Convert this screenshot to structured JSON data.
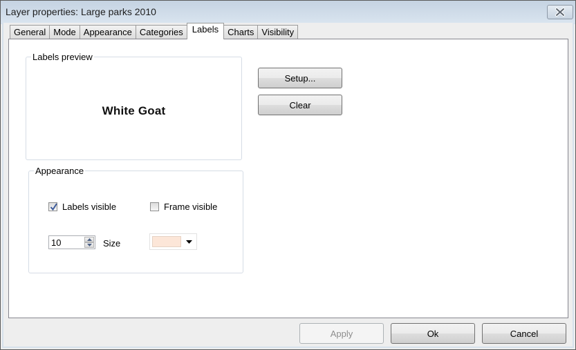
{
  "window": {
    "title": "Layer properties: Large parks 2010",
    "close_icon": "close-icon"
  },
  "tabs": [
    {
      "label": "General",
      "active": false
    },
    {
      "label": "Mode",
      "active": false
    },
    {
      "label": "Appearance",
      "active": false
    },
    {
      "label": "Categories",
      "active": false
    },
    {
      "label": "Labels",
      "active": true
    },
    {
      "label": "Charts",
      "active": false
    },
    {
      "label": "Visibility",
      "active": false
    }
  ],
  "labels_tab": {
    "preview": {
      "group_label": "Labels preview",
      "sample_text": "White Goat"
    },
    "buttons": {
      "setup": "Setup...",
      "clear": "Clear"
    },
    "appearance": {
      "group_label": "Appearance",
      "labels_visible": {
        "label": "Labels visible",
        "checked": true
      },
      "frame_visible": {
        "label": "Frame visible",
        "checked": false
      },
      "size": {
        "value": "10",
        "label": "Size"
      },
      "color": {
        "value": "#fce6d8"
      }
    }
  },
  "footer": {
    "apply": "Apply",
    "ok": "Ok",
    "cancel": "Cancel",
    "apply_enabled": false
  }
}
